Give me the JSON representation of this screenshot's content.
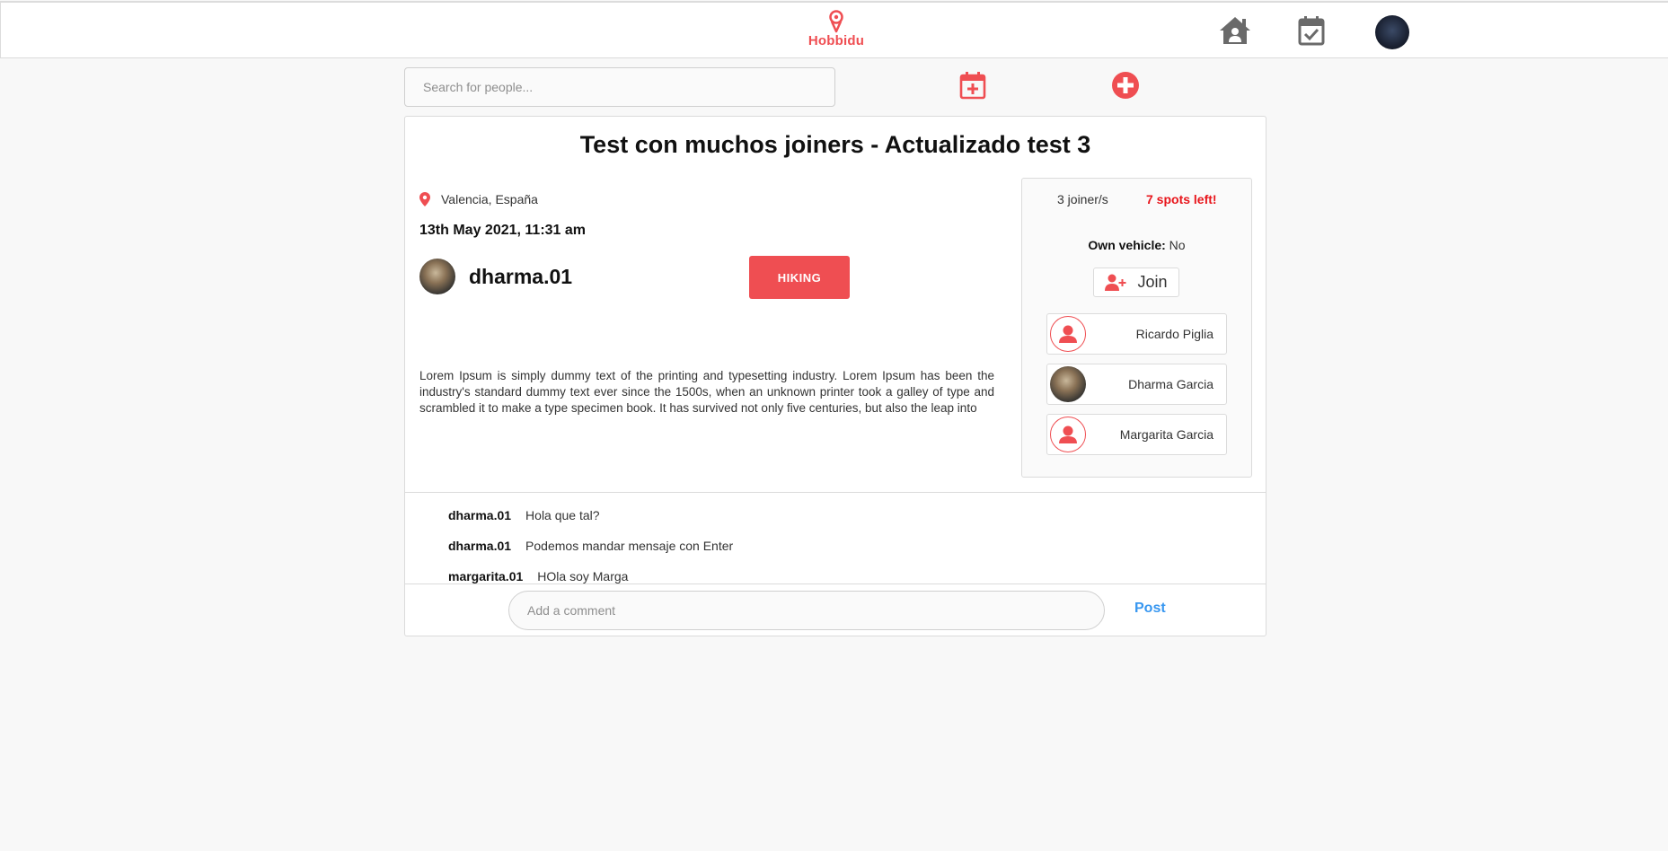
{
  "header": {
    "logo_text": "Hobbidu"
  },
  "toolbar": {
    "search_placeholder": "Search for people..."
  },
  "event": {
    "title": "Test con muchos joiners - Actualizado test 3",
    "location": "Valencia, España",
    "date": "13th May 2021, 11:31 am",
    "host_username": "dharma.01",
    "category": "HIKING",
    "description": "Lorem Ipsum is simply dummy text of the printing and typesetting industry. Lorem Ipsum has been the industry's standard dummy text ever since the 1500s, when an unknown printer took a galley of type and scrambled it to make a type specimen book. It has survived not only five centuries, but also the leap into"
  },
  "sidebar": {
    "joiners_count": "3 joiner/s",
    "spots_left": "7 spots left!",
    "vehicle_label": "Own vehicle:",
    "vehicle_value": " No",
    "join_label": "Join",
    "joiners": [
      {
        "name": "Ricardo Piglia",
        "avatar": "default-user-icon"
      },
      {
        "name": "Dharma Garcia",
        "avatar": "photo"
      },
      {
        "name": "Margarita Garcia",
        "avatar": "default-user-icon"
      }
    ]
  },
  "comments": [
    {
      "user": "dharma.01",
      "text": "Hola que tal?"
    },
    {
      "user": "dharma.01",
      "text": "Podemos mandar mensaje con Enter"
    },
    {
      "user": "margarita.01",
      "text": "HOla soy Marga"
    }
  ],
  "comment_box": {
    "placeholder": "Add a comment",
    "post_label": "Post"
  },
  "colors": {
    "accent": "#ef4e52",
    "link": "#3897f0",
    "spots": "#e8151b",
    "icon_gray": "#6a6a6a"
  }
}
